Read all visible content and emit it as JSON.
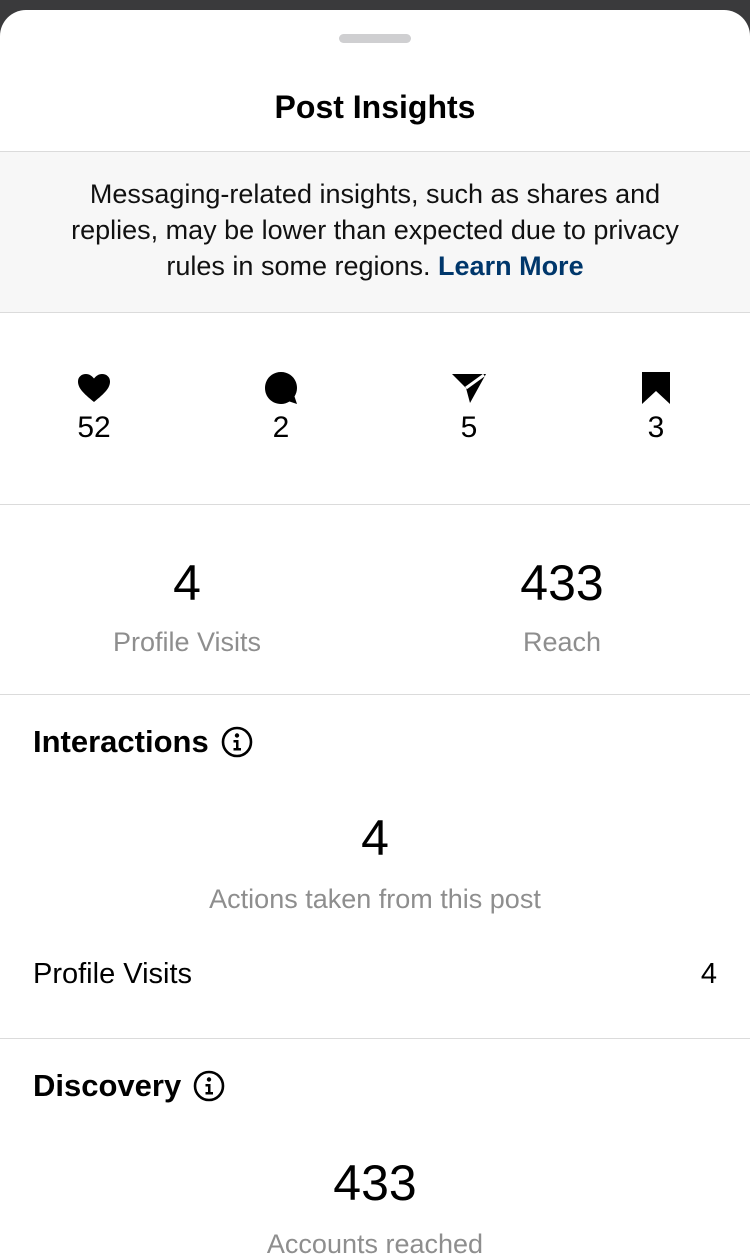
{
  "sheet": {
    "title": "Post Insights"
  },
  "notice": {
    "text": "Messaging-related insights, such as shares and replies, may be lower than expected due to privacy rules in some regions.",
    "link_label": "Learn More"
  },
  "engagement": [
    {
      "icon": "heart-icon",
      "value": "52"
    },
    {
      "icon": "comment-icon",
      "value": "2"
    },
    {
      "icon": "share-icon",
      "value": "5"
    },
    {
      "icon": "bookmark-icon",
      "value": "3"
    }
  ],
  "summary": {
    "profile_visits": {
      "value": "4",
      "label": "Profile Visits"
    },
    "reach": {
      "value": "433",
      "label": "Reach"
    }
  },
  "interactions": {
    "title": "Interactions",
    "total": "4",
    "total_label": "Actions taken from this post",
    "rows": [
      {
        "label": "Profile Visits",
        "value": "4"
      }
    ]
  },
  "discovery": {
    "title": "Discovery",
    "total": "433",
    "total_label": "Accounts reached"
  },
  "colors": {
    "link": "#00376b",
    "secondary_text": "#8e8e8e",
    "divider": "#dbdbdb",
    "notice_bg": "#f7f7f7"
  }
}
